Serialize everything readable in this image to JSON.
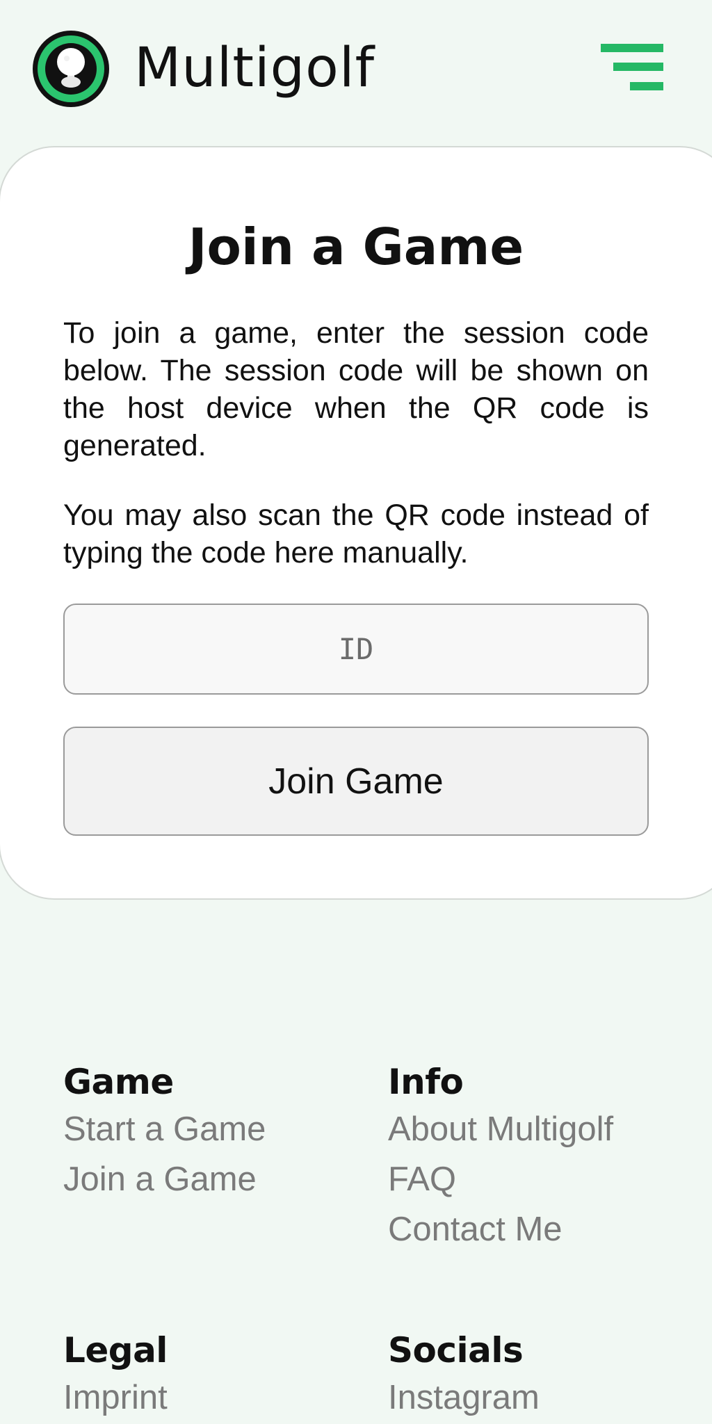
{
  "header": {
    "brand": "Multigolf",
    "logo_icon": "golf-ball-icon",
    "menu_icon": "menu-icon"
  },
  "card": {
    "title": "Join a Game",
    "paragraph_1": "To join a game, enter the session code below. The session code will be shown on the host device when the QR code is generated.",
    "paragraph_2": "You may also scan the QR code instead of typing the code here manually.",
    "id_input": {
      "placeholder": "ID",
      "value": ""
    },
    "join_button_label": "Join Game"
  },
  "footer": {
    "game": {
      "heading": "Game",
      "links": [
        "Start a Game",
        "Join a Game"
      ]
    },
    "info": {
      "heading": "Info",
      "links": [
        "About Multigolf",
        "FAQ",
        "Contact Me"
      ]
    },
    "legal": {
      "heading": "Legal",
      "links": [
        "Imprint"
      ]
    },
    "socials": {
      "heading": "Socials",
      "links": [
        "Instagram"
      ]
    }
  },
  "colors": {
    "brand_green": "#25b865",
    "page_background": "#f1f8f3",
    "link_gray": "#7a7a7a"
  }
}
